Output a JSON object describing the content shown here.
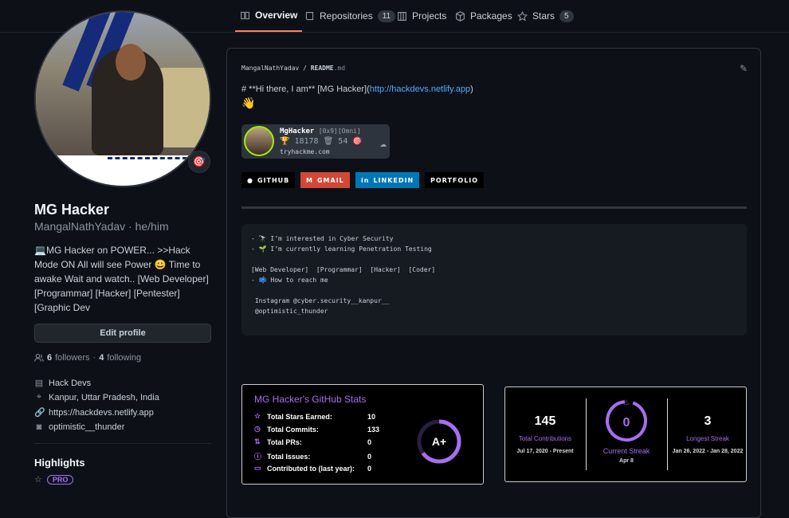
{
  "tabs": [
    {
      "label": "Overview",
      "count": "",
      "icon": "book-icon",
      "active": true
    },
    {
      "label": "Repositories",
      "count": "11",
      "icon": "repo-icon"
    },
    {
      "label": "Projects",
      "count": "",
      "icon": "project-icon"
    },
    {
      "label": "Packages",
      "count": "",
      "icon": "package-icon"
    },
    {
      "label": "Stars",
      "count": "5",
      "icon": "star-icon"
    }
  ],
  "profile": {
    "name": "MG Hacker",
    "login": "MangalNathYadav · he/him",
    "status_emoji": "🎯",
    "bio": "💻MG Hacker on POWER... >>Hack Mode ON All will see Power 😀 Time to awake Wait and watch.. [Web Developer] [Programmar] [Hacker] [Pentester] [Graphic Dev",
    "edit_label": "Edit profile",
    "followers": "6",
    "followers_label": "followers",
    "dot": "·",
    "following": "4",
    "following_label": "following",
    "company": "Hack Devs",
    "location": "Kanpur, Uttar Pradesh, India",
    "website": "https://hackdevs.netlify.app",
    "instagram": "optimistic__thunder",
    "highlights_title": "Highlights",
    "pro_label": "PRO"
  },
  "readme": {
    "path_user": "MangalNathYadav",
    "path_sep": " / ",
    "path_file": "README",
    "path_ext": ".md",
    "hi_text": "# **Hi there, I am** [MG Hacker](",
    "hi_link": "http://hackdevs.netlify.app",
    "hi_end": ")",
    "wave": "👋",
    "thm": {
      "user": "MgHacker",
      "tags": "[0x9][Omni]",
      "line2": "🏆 18178 🗑 54 🎯",
      "domain": "tryhackme.com"
    },
    "social": [
      {
        "label": "GITHUB",
        "color": "#000000",
        "icon": "github-icon"
      },
      {
        "label": "GMAIL",
        "color": "#d14836",
        "icon": "gmail-icon"
      },
      {
        "label": "LINKEDIN",
        "color": "#0077b5",
        "icon": "linkedin-icon"
      },
      {
        "label": "PORTFOLIO",
        "color": "#000000",
        "icon": ""
      }
    ],
    "code": "- 🔭 I’m interested in Cyber Security\n- 🌱 I’m currently learning Penetration Testing\n\n[Web Developer]  [Programmar]  [Hacker]  [Coder]\n- 📫 How to reach me\n\n Instagram @cyber.security__kanpur__\n @optimistic_thunder"
  },
  "stats": {
    "title": "MG Hacker's GitHub Stats",
    "rows": [
      {
        "label": "Total Stars Earned:",
        "value": "10",
        "icon": "star-icon"
      },
      {
        "label": "Total Commits:",
        "value": "133",
        "icon": "clock-icon"
      },
      {
        "label": "Total PRs:",
        "value": "0",
        "icon": "pr-icon"
      },
      {
        "label": "Total Issues:",
        "value": "0",
        "icon": "issue-icon"
      },
      {
        "label": "Contributed to (last year):",
        "value": "0",
        "icon": "repo-icon"
      }
    ],
    "grade": "A+",
    "grade_progress": 0.65
  },
  "streak": {
    "total": "145",
    "total_label": "Total Contributions",
    "total_range": "Jul 17, 2020 - Present",
    "current": "0",
    "current_label": "Current Streak",
    "current_date": "Apr 8",
    "longest": "3",
    "longest_label": "Longest Streak",
    "longest_range": "Jan 26, 2022 - Jan 28, 2022"
  },
  "colors": {
    "accent": "#f78166",
    "purple": "#a66ff0",
    "link": "#58a6ff"
  }
}
